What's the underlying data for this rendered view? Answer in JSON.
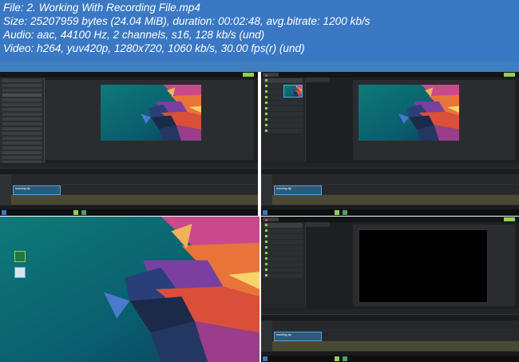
{
  "info": {
    "file": "File: 2. Working With Recording File.mp4",
    "size": "Size: 25207959 bytes (24.04 MiB), duration: 00:02:48, avg.bitrate: 1200 kb/s",
    "audio": "Audio: aac, 44100 Hz, 2 channels, s16, 128 kb/s (und)",
    "video": "Video: h264, yuv420p, 1280x720, 1060 kb/s, 30.00 fps(r) (und)"
  },
  "frames": [
    {
      "name": "frame-1-editor-menu-open"
    },
    {
      "name": "frame-2-editor-media-bin"
    },
    {
      "name": "frame-3-desktop"
    },
    {
      "name": "frame-4-editor-black-canvas"
    }
  ],
  "colors": {
    "header_bg": "#3a78c4",
    "editor_bg": "#1d1f22",
    "accent_green": "#8fd14f",
    "clip_blue": "#2a5b7a",
    "record_red": "#e24a4a"
  },
  "icons": [
    "record-icon",
    "play-icon",
    "share-icon",
    "windows-start-icon",
    "app-icon",
    "file-icon"
  ]
}
